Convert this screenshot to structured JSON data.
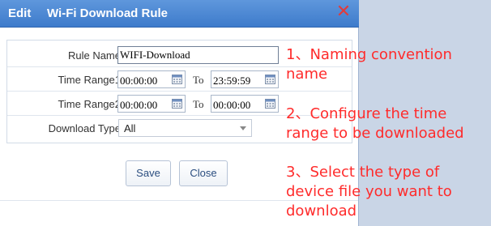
{
  "dialog": {
    "title_prefix": "Edit",
    "title": "Wi-Fi Download Rule",
    "close_glyph": "✕"
  },
  "form": {
    "rule_name": {
      "label": "Rule Name",
      "value": "WIFI-Download"
    },
    "time_range1": {
      "label": "Time Range1",
      "start": "00:00:00",
      "to": "To",
      "end": "23:59:59"
    },
    "time_range2": {
      "label": "Time Range2",
      "start": "00:00:00",
      "to": "To",
      "end": "00:00:00"
    },
    "download_type": {
      "label": "Download Type",
      "value": "All"
    }
  },
  "buttons": {
    "save": "Save",
    "close": "Close"
  },
  "annotations": {
    "note1": "1、Naming convention name",
    "note2": "2、Configure the time range to be downloaded",
    "note3": "3、Select the type of device file you want to download"
  },
  "colors": {
    "annotation": "#ff2b2b",
    "titlebar": "#4a86d4",
    "close_icon": "#e23b3b"
  }
}
